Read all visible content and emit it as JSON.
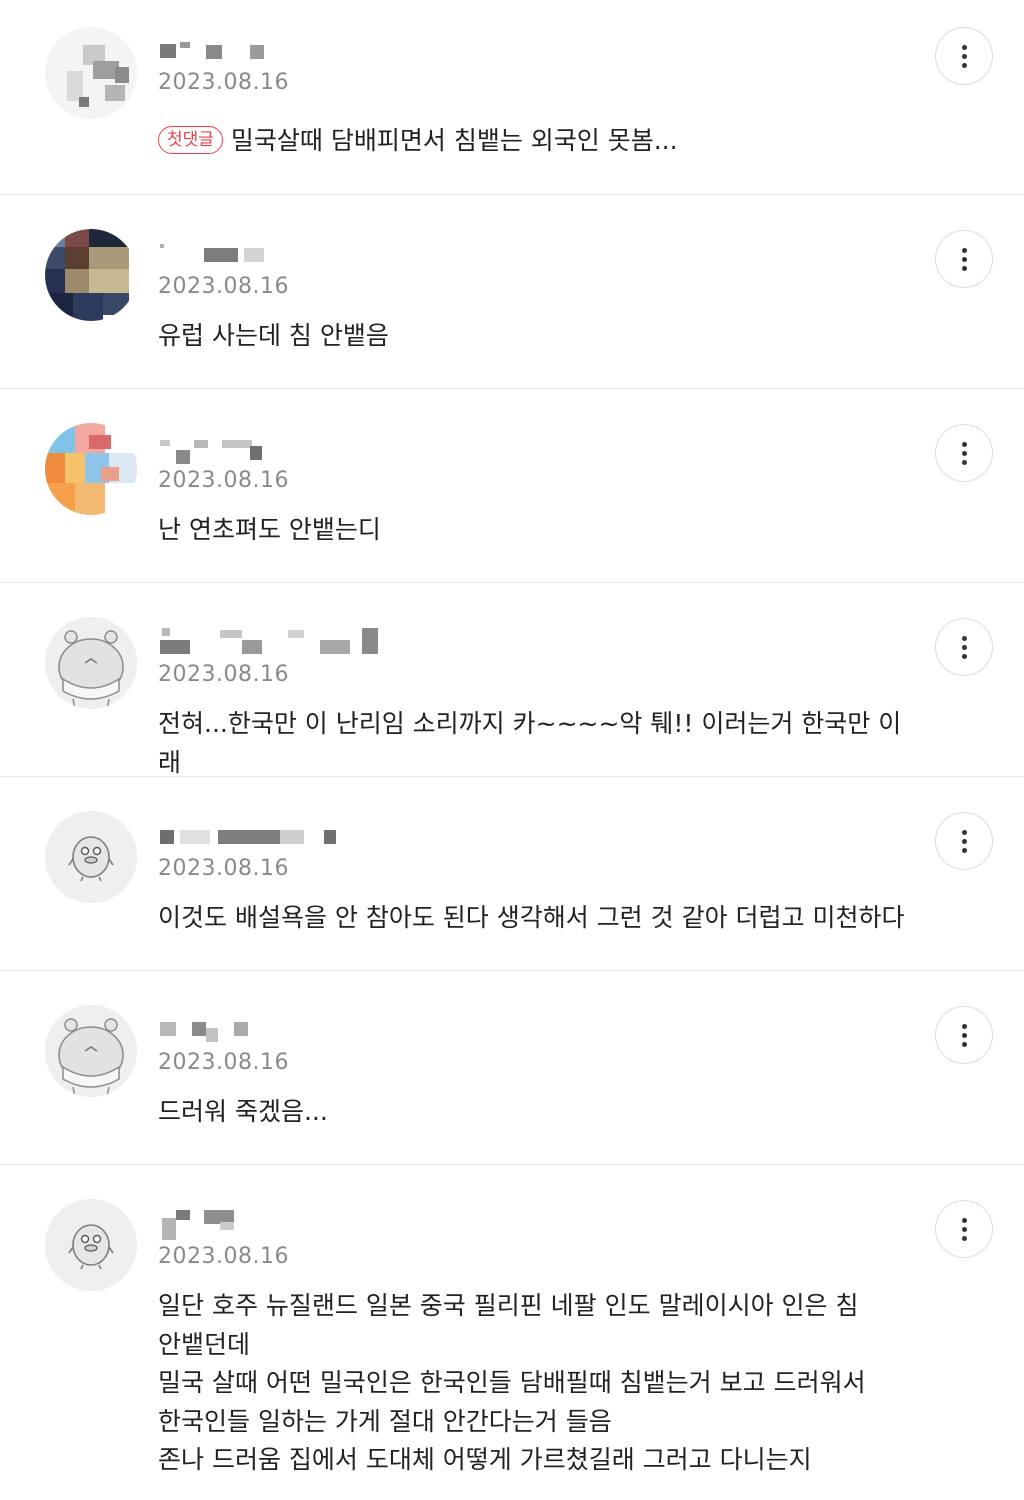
{
  "comments": [
    {
      "date": "2023.08.16",
      "badge": "첫댓글",
      "text": "밀국살때 담배피면서 침뱉는 외국인 못봄...",
      "avatar_icon": "blurred-photo-avatar"
    },
    {
      "date": "2023.08.16",
      "text": "유럽 사는데 침 안뱉음",
      "avatar_icon": "blurred-photo-avatar"
    },
    {
      "date": "2023.08.16",
      "text": "난 연초펴도 안뱉는디",
      "avatar_icon": "blurred-photo-avatar"
    },
    {
      "date": "2023.08.16",
      "text": "전혀...한국만 이 난리임 소리까지 카~~~~악 퉤!! 이러는거 한국만 이래",
      "avatar_icon": "default-hippo-avatar"
    },
    {
      "date": "2023.08.16",
      "text": "이것도 배설욕을 안 참아도 된다 생각해서 그런 것 같아 더럽고 미천하다",
      "avatar_icon": "default-bird-avatar"
    },
    {
      "date": "2023.08.16",
      "text": "드러워 죽겠음...",
      "avatar_icon": "default-hippo-avatar"
    },
    {
      "date": "2023.08.16",
      "text": "일단 호주 뉴질랜드 일본 중국 필리핀 네팔 인도 말레이시아 인은 침\n안뱉던데\n밀국 살때 어떤 밀국인은 한국인들 담배필때 침뱉는거 보고 드러워서\n한국인들 일하는 가게 절대 안간다는거 들음\n존나 드러움 집에서 도대체 어떻게 가르쳤길래 그러고 다니는지",
      "avatar_icon": "default-bird-avatar"
    }
  ],
  "colors": {
    "badge": "#e8434b",
    "date": "#8a8a8a",
    "text": "#222222",
    "divider": "#e9e9e9"
  },
  "icons": {
    "more": "more-vertical-icon"
  }
}
